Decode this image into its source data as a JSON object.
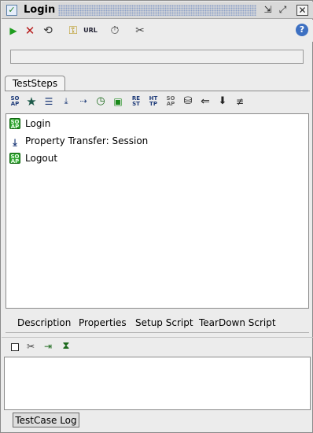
{
  "window": {
    "title": "Login",
    "app_icon": "check-icon",
    "buttons": [
      "minimize-icon",
      "maximize-icon",
      "close-icon"
    ]
  },
  "toolbar": {
    "items": [
      "run-icon",
      "cancel-icon",
      "loop-icon",
      "credentials-icon",
      "url-icon",
      "timer-icon",
      "tools-icon",
      "help-icon"
    ],
    "url_text": "URL",
    "help_text": "?"
  },
  "tabs": {
    "active": "TestSteps"
  },
  "step_toolbar": {
    "soap": "SO AP",
    "rest": "RE ST",
    "http": "HT TP",
    "amf": "SO AP"
  },
  "steps": [
    {
      "type": "soap",
      "label": "Login"
    },
    {
      "type": "property-transfer",
      "label": "Property Transfer: Session"
    },
    {
      "type": "soap",
      "label": "Logout"
    }
  ],
  "soap_icon_text": "SO AP",
  "bottom_tabs": [
    "Description",
    "Properties",
    "Setup Script",
    "TearDown Script"
  ],
  "log_tab": "TestCase Log",
  "colors": {
    "run": "#1f9d1f",
    "cancel": "#b71c1c",
    "soap_step": "#2ea32e",
    "help": "#3d70c2"
  }
}
